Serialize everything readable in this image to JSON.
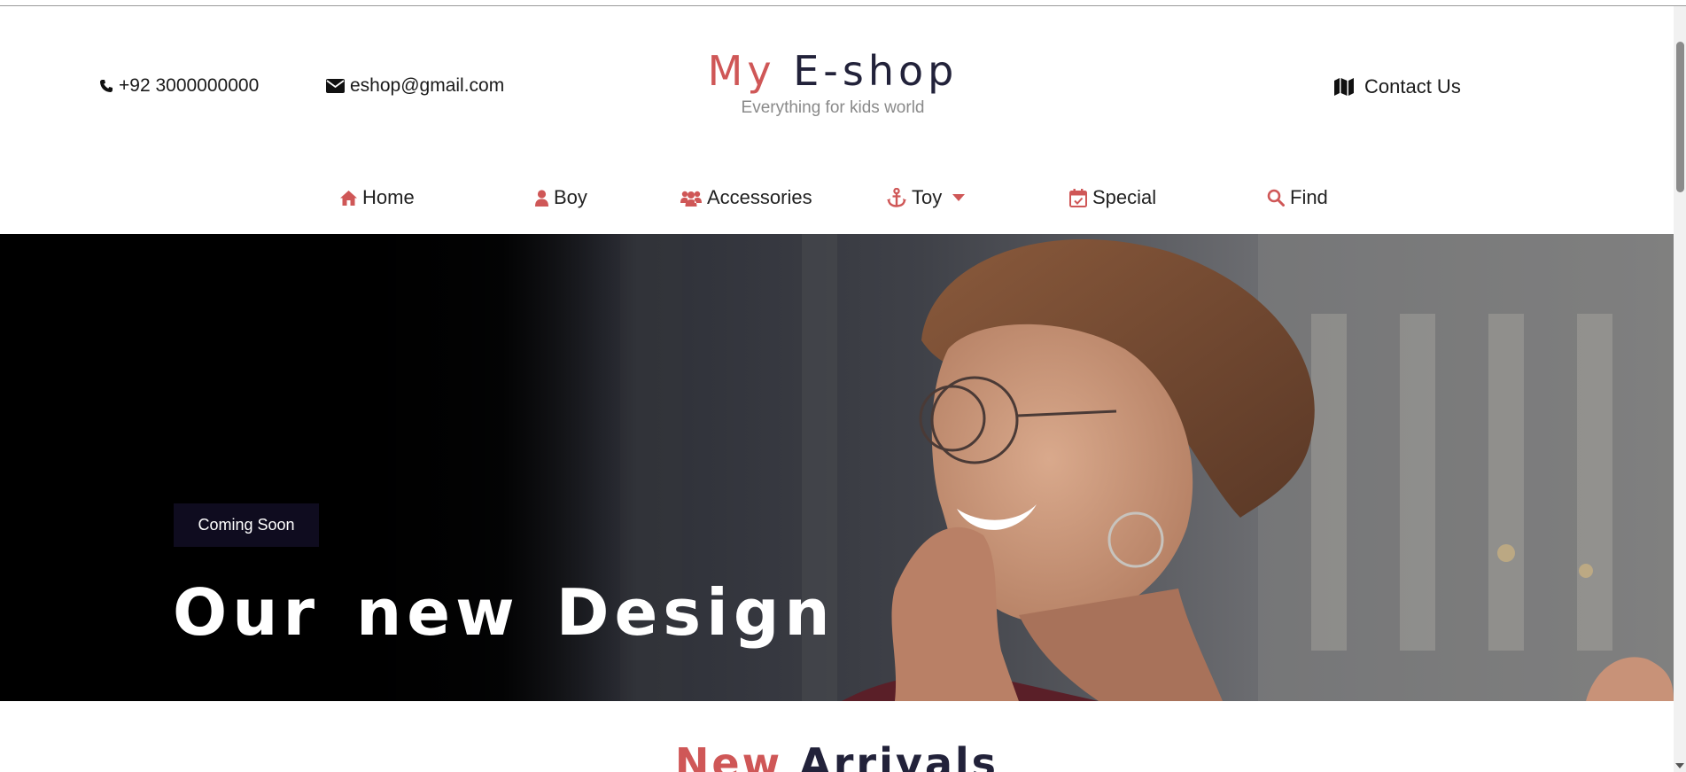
{
  "header": {
    "phone": "+92 3000000000",
    "email": "eshop@gmail.com",
    "contact_label": "Contact Us",
    "brand_accent": "My",
    "brand_rest": "E-shop",
    "tagline": "Everything for kids world"
  },
  "nav": {
    "items": [
      {
        "label": "Home",
        "icon": "home-icon"
      },
      {
        "label": "Boy",
        "icon": "user-icon"
      },
      {
        "label": "Accessories",
        "icon": "users-icon"
      },
      {
        "label": "Toy",
        "icon": "anchor-icon",
        "has_dropdown": true
      },
      {
        "label": "Special",
        "icon": "calendar-check-icon"
      },
      {
        "label": "Find",
        "icon": "search-icon"
      }
    ]
  },
  "hero": {
    "badge": "Coming Soon",
    "title": "Our new Design"
  },
  "section": {
    "title_accent": "New",
    "title_rest": "Arrivals"
  },
  "colors": {
    "accent": "#cf5757",
    "brand_dark": "#22223a",
    "badge_bg": "#0f0c1f"
  }
}
